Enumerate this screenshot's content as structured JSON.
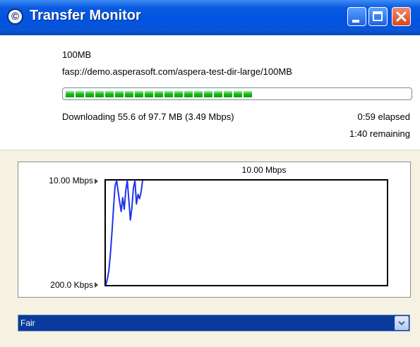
{
  "window": {
    "title": "Transfer Monitor",
    "app_icon": "aspera-logo-icon",
    "app_icon_glyph": "©",
    "controls": [
      "minimize-icon",
      "maximize-icon",
      "close-icon"
    ]
  },
  "transfer": {
    "file_name": "100MB",
    "url": "fasp://demo.asperasoft.com/aspera-test-dir-large/100MB",
    "progress": 0.569,
    "status": "Downloading 55.6 of 97.7 MB (3.49 Mbps)",
    "elapsed": "0:59 elapsed",
    "remaining": "1:40 remaining"
  },
  "chart_data": {
    "type": "line",
    "title": "10.00 Mbps",
    "ymax_label": "10.00 Mbps",
    "ymin_label": "200.0 Kbps",
    "ylim": [
      200,
      10000
    ],
    "y_units": "Kbps",
    "grid": false,
    "color": "#2233ee",
    "series": [
      {
        "values": [
          200,
          800,
          1600,
          3200,
          5200,
          7400,
          9500,
          10000,
          9000,
          8000,
          7100,
          8400,
          7300,
          9100,
          10000,
          8200,
          6300,
          7400,
          9300,
          10000,
          7800,
          8700,
          8300,
          8900,
          10000
        ]
      }
    ]
  },
  "controls": {
    "policy_selected": "Fair",
    "dropdown_icon": "chevron-down-icon"
  }
}
